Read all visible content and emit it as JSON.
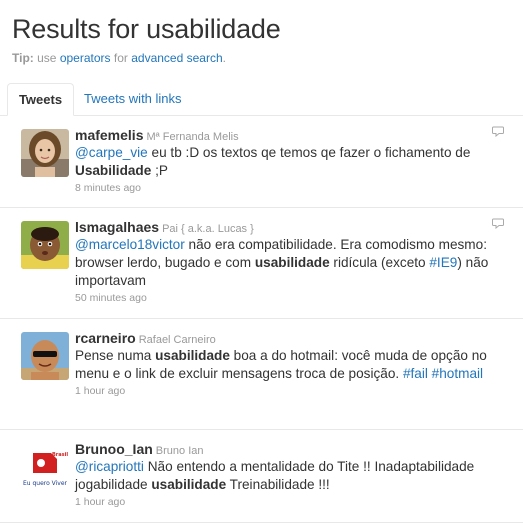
{
  "header": {
    "title": "Results for usabilidade",
    "tip_label": "Tip:",
    "tip_use": "use",
    "tip_operators": "operators",
    "tip_for": "for",
    "tip_advanced": "advanced search",
    "tip_end": "."
  },
  "tabs": [
    {
      "label": "Tweets"
    },
    {
      "label": "Tweets with links"
    }
  ],
  "colors": {
    "link": "#2276bb",
    "muted": "#999999",
    "border": "#e8e8e8"
  },
  "tweets": [
    {
      "screen_name": "mafemelis",
      "full_name": "Mª Fernanda Melis",
      "mention": "@carpe_vie",
      "text_a": " eu tb :D os textos qe temos qe fazer o fichamento de ",
      "highlight": "Usabilidade",
      "text_b": " ;P",
      "time": "8 minutes ago",
      "avatar_icon": "woman-avatar-icon"
    },
    {
      "screen_name": "lsmagalhaes",
      "full_name": "Pai { a.k.a. Lucas }",
      "mention": "@marcelo18victor",
      "text_a": " não era compatibilidade. Era comodismo mesmo: browser lerdo, bugado e com ",
      "highlight": "usabilidade",
      "text_b": " ridícula (exceto ",
      "hashtag": "#IE9",
      "text_c": ") não importavam",
      "time": "50 minutes ago",
      "avatar_icon": "child-avatar-icon"
    },
    {
      "screen_name": "rcarneiro",
      "full_name": "Rafael Carneiro",
      "text_a": "Pense numa ",
      "highlight": "usabilidade",
      "text_b": " boa a do hotmail: você muda de opção no menu e o link de excluir mensagens troca de posição. ",
      "hashtag": "#fail",
      "hashtag2": "#hotmail",
      "time": "1 hour ago",
      "avatar_icon": "man-sunglasses-avatar-icon"
    },
    {
      "screen_name": "Brunoo_Ian",
      "full_name": "Bruno Ian",
      "mention": "@ricapriotti",
      "text_a": " Não entendo a mentalidade do Tite !! Inadaptabilidade jogabilidade ",
      "highlight": "usabilidade",
      "text_b": " Treinabilidade !!!",
      "time": "1 hour ago",
      "avatar_icon": "logo-avatar-icon",
      "avatar_text_top": "Brasil",
      "avatar_text": "Eu quero Viver"
    }
  ]
}
